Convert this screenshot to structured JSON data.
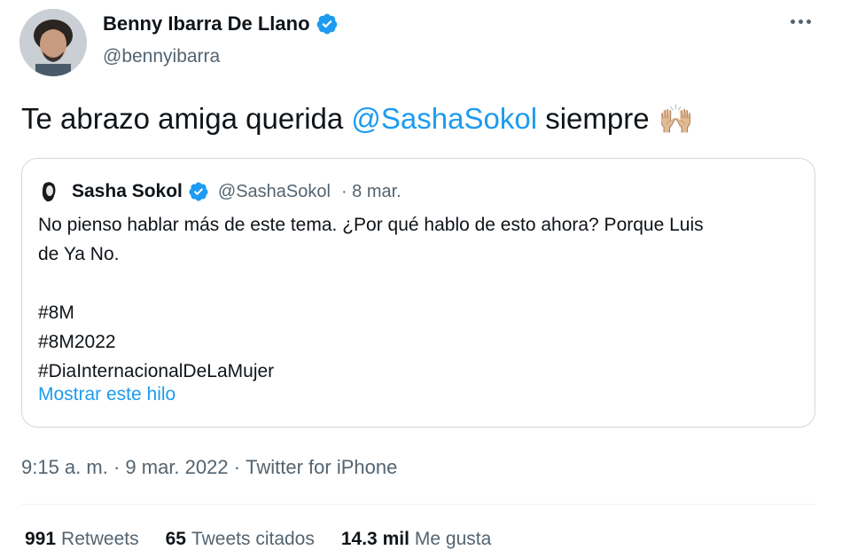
{
  "author": {
    "name": "Benny Ibarra De Llano",
    "handle": "@bennyibarra"
  },
  "tweet": {
    "text_before": "Te abrazo amiga querida ",
    "mention": "@SashaSokol",
    "text_after": " siempre",
    "emoji": "🙌🏼"
  },
  "quote": {
    "name": "Sasha Sokol",
    "handle": "@SashaSokol",
    "date": "· 8 mar.",
    "lines": [
      "No pienso hablar más de este tema. ¿Por qué hablo de esto ahora? Porque Luis",
      "de Ya No."
    ],
    "hashtags": [
      "#8M",
      "#8M2022",
      "#DiaInternacionalDeLaMujer"
    ],
    "show_thread": "Mostrar este hilo"
  },
  "meta": {
    "time": "9:15 a. m.",
    "sep1": " · ",
    "date": "9 mar. 2022",
    "sep2": " · ",
    "source": "Twitter for iPhone"
  },
  "stats": {
    "retweets_count": "991",
    "retweets_label": "Retweets",
    "quotes_count": "65",
    "quotes_label": "Tweets citados",
    "likes_count": "14.3 mil",
    "likes_label": "Me gusta"
  },
  "icons": {
    "verified": "verified-badge-icon",
    "more": "more-options-icon"
  },
  "colors": {
    "accent": "#1d9bf0",
    "text": "#0f1419",
    "secondary": "#536471",
    "border": "#cfd9de"
  }
}
